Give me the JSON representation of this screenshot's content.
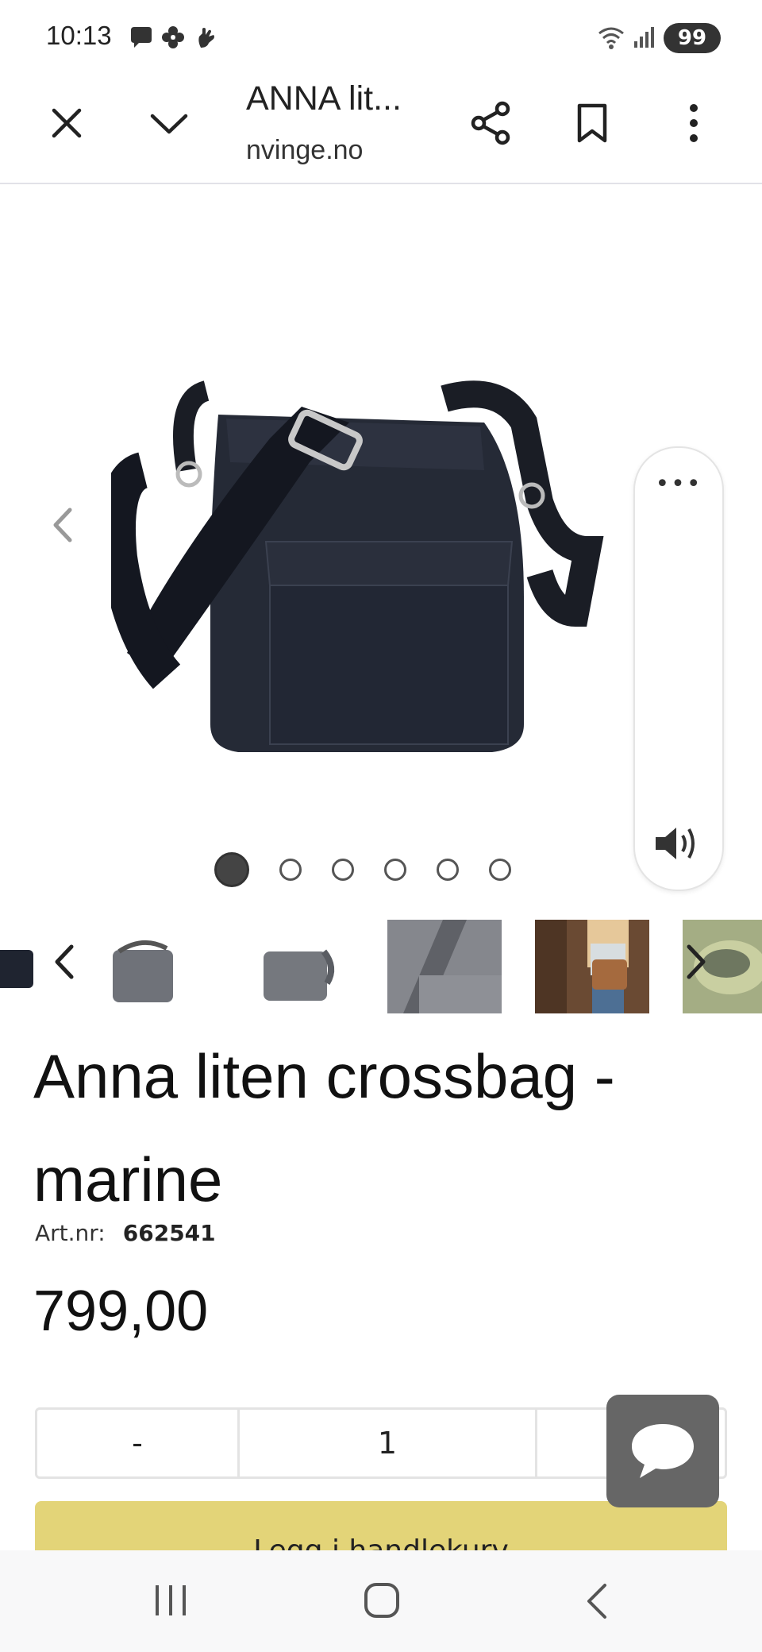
{
  "status_bar": {
    "time": "10:13",
    "icons": [
      "chat-bubble-icon",
      "flower-icon",
      "hand-icon",
      "wifi-icon",
      "signal-icon"
    ],
    "battery": "99"
  },
  "browser_bar": {
    "title": "ANNA lit...",
    "url": "nvinge.no",
    "icons": [
      "close-icon",
      "chevron-down-icon",
      "share-icon",
      "bookmark-icon",
      "more-vertical-icon"
    ]
  },
  "gallery": {
    "dot_count": 6,
    "active_index": 0,
    "panel_menu": "•••"
  },
  "thumbnails": [
    "navy-bag-thumb",
    "grey-bag-thumb-1",
    "grey-bag-thumb-2",
    "strap-closeup-thumb",
    "person-with-bag-thumb",
    "green-bag-thumb"
  ],
  "product": {
    "title": "Anna liten crossbag - marine",
    "artnr_label": "Art.nr:",
    "artnr_value": "662541",
    "price": "799,00"
  },
  "quantity": {
    "minus": "-",
    "value": "1",
    "plus": "+"
  },
  "cart_button": "Legg i handlekurv",
  "colors": {
    "cart": "#e3d478",
    "chat": "#666666",
    "bag": "#1f2430"
  }
}
